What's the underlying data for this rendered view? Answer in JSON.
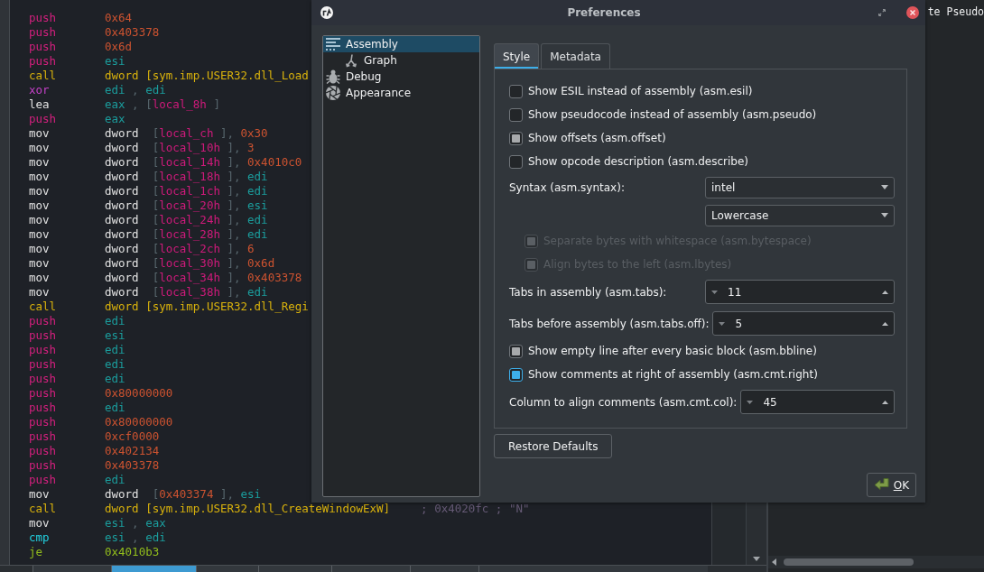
{
  "code_view": {
    "lines": [
      {
        "mnemonic": "push",
        "kind": "stack",
        "operands": [
          {
            "text": "0x64",
            "kind": "number"
          }
        ]
      },
      {
        "mnemonic": "push",
        "kind": "stack",
        "operands": [
          {
            "text": "0x403378",
            "kind": "number"
          }
        ]
      },
      {
        "mnemonic": "push",
        "kind": "stack",
        "operands": [
          {
            "text": "0x6d",
            "kind": "number"
          }
        ]
      },
      {
        "mnemonic": "push",
        "kind": "stack",
        "operands": [
          {
            "text": "esi",
            "kind": "register"
          }
        ]
      },
      {
        "mnemonic": "call",
        "kind": "call",
        "operands": [
          {
            "text": "dword [sym.imp.USER32.dll_Load",
            "kind": "call_target"
          }
        ]
      },
      {
        "mnemonic": "xor",
        "kind": "logic",
        "operands": [
          {
            "text": "edi",
            "kind": "register"
          },
          {
            "text": " , ",
            "kind": "punct"
          },
          {
            "text": "edi",
            "kind": "register"
          }
        ]
      },
      {
        "mnemonic": "lea",
        "kind": "move",
        "operands": [
          {
            "text": "eax",
            "kind": "register"
          },
          {
            "text": " , [",
            "kind": "punct"
          },
          {
            "text": "local_8h",
            "kind": "variable"
          },
          {
            "text": " ]",
            "kind": "punct"
          }
        ]
      },
      {
        "mnemonic": "push",
        "kind": "stack",
        "operands": [
          {
            "text": "eax",
            "kind": "register"
          }
        ]
      },
      {
        "mnemonic": "mov",
        "kind": "move",
        "operands": [
          {
            "text": "dword",
            "kind": "keyword"
          },
          {
            "text": "  [",
            "kind": "punct"
          },
          {
            "text": "local_ch",
            "kind": "variable"
          },
          {
            "text": " ], ",
            "kind": "punct"
          },
          {
            "text": "0x30",
            "kind": "number"
          }
        ]
      },
      {
        "mnemonic": "mov",
        "kind": "move",
        "operands": [
          {
            "text": "dword",
            "kind": "keyword"
          },
          {
            "text": "  [",
            "kind": "punct"
          },
          {
            "text": "local_10h",
            "kind": "variable"
          },
          {
            "text": " ], ",
            "kind": "punct"
          },
          {
            "text": "3",
            "kind": "number"
          }
        ]
      },
      {
        "mnemonic": "mov",
        "kind": "move",
        "operands": [
          {
            "text": "dword",
            "kind": "keyword"
          },
          {
            "text": "  [",
            "kind": "punct"
          },
          {
            "text": "local_14h",
            "kind": "variable"
          },
          {
            "text": " ], ",
            "kind": "punct"
          },
          {
            "text": "0x4010c0",
            "kind": "number"
          }
        ]
      },
      {
        "mnemonic": "mov",
        "kind": "move",
        "operands": [
          {
            "text": "dword",
            "kind": "keyword"
          },
          {
            "text": "  [",
            "kind": "punct"
          },
          {
            "text": "local_18h",
            "kind": "variable"
          },
          {
            "text": " ], ",
            "kind": "punct"
          },
          {
            "text": "edi",
            "kind": "register"
          }
        ]
      },
      {
        "mnemonic": "mov",
        "kind": "move",
        "operands": [
          {
            "text": "dword",
            "kind": "keyword"
          },
          {
            "text": "  [",
            "kind": "punct"
          },
          {
            "text": "local_1ch",
            "kind": "variable"
          },
          {
            "text": " ], ",
            "kind": "punct"
          },
          {
            "text": "edi",
            "kind": "register"
          }
        ]
      },
      {
        "mnemonic": "mov",
        "kind": "move",
        "operands": [
          {
            "text": "dword",
            "kind": "keyword"
          },
          {
            "text": "  [",
            "kind": "punct"
          },
          {
            "text": "local_20h",
            "kind": "variable"
          },
          {
            "text": " ], ",
            "kind": "punct"
          },
          {
            "text": "esi",
            "kind": "register"
          }
        ]
      },
      {
        "mnemonic": "mov",
        "kind": "move",
        "operands": [
          {
            "text": "dword",
            "kind": "keyword"
          },
          {
            "text": "  [",
            "kind": "punct"
          },
          {
            "text": "local_24h",
            "kind": "variable"
          },
          {
            "text": " ], ",
            "kind": "punct"
          },
          {
            "text": "edi",
            "kind": "register"
          }
        ]
      },
      {
        "mnemonic": "mov",
        "kind": "move",
        "operands": [
          {
            "text": "dword",
            "kind": "keyword"
          },
          {
            "text": "  [",
            "kind": "punct"
          },
          {
            "text": "local_28h",
            "kind": "variable"
          },
          {
            "text": " ], ",
            "kind": "punct"
          },
          {
            "text": "edi",
            "kind": "register"
          }
        ]
      },
      {
        "mnemonic": "mov",
        "kind": "move",
        "operands": [
          {
            "text": "dword",
            "kind": "keyword"
          },
          {
            "text": "  [",
            "kind": "punct"
          },
          {
            "text": "local_2ch",
            "kind": "variable"
          },
          {
            "text": " ], ",
            "kind": "punct"
          },
          {
            "text": "6",
            "kind": "number"
          }
        ]
      },
      {
        "mnemonic": "mov",
        "kind": "move",
        "operands": [
          {
            "text": "dword",
            "kind": "keyword"
          },
          {
            "text": "  [",
            "kind": "punct"
          },
          {
            "text": "local_30h",
            "kind": "variable"
          },
          {
            "text": " ], ",
            "kind": "punct"
          },
          {
            "text": "0x6d",
            "kind": "number"
          }
        ]
      },
      {
        "mnemonic": "mov",
        "kind": "move",
        "operands": [
          {
            "text": "dword",
            "kind": "keyword"
          },
          {
            "text": "  [",
            "kind": "punct"
          },
          {
            "text": "local_34h",
            "kind": "variable"
          },
          {
            "text": " ], ",
            "kind": "punct"
          },
          {
            "text": "0x403378",
            "kind": "number"
          }
        ]
      },
      {
        "mnemonic": "mov",
        "kind": "move",
        "operands": [
          {
            "text": "dword",
            "kind": "keyword"
          },
          {
            "text": "  [",
            "kind": "punct"
          },
          {
            "text": "local_38h",
            "kind": "variable"
          },
          {
            "text": " ], ",
            "kind": "punct"
          },
          {
            "text": "edi",
            "kind": "register"
          }
        ]
      },
      {
        "mnemonic": "call",
        "kind": "call",
        "operands": [
          {
            "text": "dword [sym.imp.USER32.dll_Regi",
            "kind": "call_target"
          }
        ]
      },
      {
        "mnemonic": "push",
        "kind": "stack",
        "operands": [
          {
            "text": "edi",
            "kind": "register"
          }
        ]
      },
      {
        "mnemonic": "push",
        "kind": "stack",
        "operands": [
          {
            "text": "esi",
            "kind": "register"
          }
        ]
      },
      {
        "mnemonic": "push",
        "kind": "stack",
        "operands": [
          {
            "text": "edi",
            "kind": "register"
          }
        ]
      },
      {
        "mnemonic": "push",
        "kind": "stack",
        "operands": [
          {
            "text": "edi",
            "kind": "register"
          }
        ]
      },
      {
        "mnemonic": "push",
        "kind": "stack",
        "operands": [
          {
            "text": "edi",
            "kind": "register"
          }
        ]
      },
      {
        "mnemonic": "push",
        "kind": "stack",
        "operands": [
          {
            "text": "0x80000000",
            "kind": "number"
          }
        ]
      },
      {
        "mnemonic": "push",
        "kind": "stack",
        "operands": [
          {
            "text": "edi",
            "kind": "register"
          }
        ]
      },
      {
        "mnemonic": "push",
        "kind": "stack",
        "operands": [
          {
            "text": "0x80000000",
            "kind": "number"
          }
        ]
      },
      {
        "mnemonic": "push",
        "kind": "stack",
        "operands": [
          {
            "text": "0xcf0000",
            "kind": "number"
          }
        ]
      },
      {
        "mnemonic": "push",
        "kind": "stack",
        "operands": [
          {
            "text": "0x402134",
            "kind": "number"
          }
        ]
      },
      {
        "mnemonic": "push",
        "kind": "stack",
        "operands": [
          {
            "text": "0x403378",
            "kind": "number"
          }
        ]
      },
      {
        "mnemonic": "push",
        "kind": "stack",
        "operands": [
          {
            "text": "edi",
            "kind": "register"
          }
        ]
      },
      {
        "mnemonic": "mov",
        "kind": "move",
        "operands": [
          {
            "text": "dword",
            "kind": "keyword"
          },
          {
            "text": "  [",
            "kind": "punct"
          },
          {
            "text": "0x403374",
            "kind": "number"
          },
          {
            "text": " ], ",
            "kind": "punct"
          },
          {
            "text": "esi",
            "kind": "register"
          }
        ]
      },
      {
        "mnemonic": "call",
        "kind": "call",
        "operands": [
          {
            "text": "dword [sym.imp.USER32.dll_CreateWindowExW]",
            "kind": "call_target"
          }
        ],
        "comment": "; 0x4020fc ; \"N\""
      },
      {
        "mnemonic": "mov",
        "kind": "move",
        "operands": [
          {
            "text": "esi",
            "kind": "register"
          },
          {
            "text": " , ",
            "kind": "punct"
          },
          {
            "text": "eax",
            "kind": "register"
          }
        ]
      },
      {
        "mnemonic": "cmp",
        "kind": "compare",
        "operands": [
          {
            "text": "esi",
            "kind": "register"
          },
          {
            "text": " , ",
            "kind": "punct"
          },
          {
            "text": "edi",
            "kind": "register"
          }
        ]
      },
      {
        "mnemonic": "je",
        "kind": "jump",
        "operands": [
          {
            "text": "0x4010b3",
            "kind": "jump_target"
          }
        ]
      }
    ]
  },
  "code_tabs": [
    {
      "selected": false
    },
    {
      "selected": true
    },
    {
      "selected": false
    },
    {
      "selected": false
    },
    {
      "selected": false
    },
    {
      "selected": false
    },
    {
      "selected": false
    }
  ],
  "right_panel": {
    "header": "te Pseudo"
  },
  "dialog": {
    "title": "Preferences",
    "sidebar": [
      {
        "label": "Assembly",
        "selected": true,
        "children": [
          {
            "label": "Graph",
            "selected": false
          }
        ]
      },
      {
        "label": "Debug",
        "selected": false
      },
      {
        "label": "Appearance",
        "selected": false
      }
    ],
    "tabs": [
      {
        "label": "Style",
        "selected": true
      },
      {
        "label": "Metadata",
        "selected": false
      }
    ],
    "settings": [
      {
        "kind": "checkbox",
        "label": "Show ESIL instead of assembly (asm.esil)",
        "checked": false,
        "disabled": false,
        "focused": false
      },
      {
        "kind": "checkbox",
        "label": "Show pseudocode instead of assembly (asm.pseudo)",
        "checked": false,
        "disabled": false,
        "focused": false
      },
      {
        "kind": "checkbox",
        "label": "Show offsets (asm.offset)",
        "checked": true,
        "disabled": false,
        "focused": false
      },
      {
        "kind": "checkbox",
        "label": "Show opcode description (asm.describe)",
        "checked": false,
        "disabled": false,
        "focused": false
      },
      {
        "kind": "combo",
        "label": "Syntax (asm.syntax):",
        "value": "intel"
      },
      {
        "kind": "combo",
        "value": "Lowercase"
      },
      {
        "kind": "sub_checkbox",
        "label": "Separate bytes with whitespace (asm.bytespace)",
        "checked": true,
        "disabled": true,
        "focused": false
      },
      {
        "kind": "sub_checkbox",
        "label": "Align bytes to the left (asm.lbytes)",
        "checked": true,
        "disabled": true,
        "focused": false
      },
      {
        "kind": "spin",
        "label": "Tabs in assembly (asm.tabs):",
        "value": "11"
      },
      {
        "kind": "spin",
        "label": "Tabs before assembly (asm.tabs.off):",
        "value": "5"
      },
      {
        "kind": "checkbox",
        "label": "Show empty line after every basic block (asm.bbline)",
        "checked": true,
        "disabled": false,
        "focused": false
      },
      {
        "kind": "checkbox",
        "label": "Show comments at right of assembly (asm.cmt.right)",
        "checked": true,
        "disabled": false,
        "focused": true
      },
      {
        "kind": "spin",
        "label": "Column to align comments (asm.cmt.col):",
        "value": "45"
      }
    ],
    "restore_button": "Restore Defaults",
    "ok_button": "OK"
  }
}
